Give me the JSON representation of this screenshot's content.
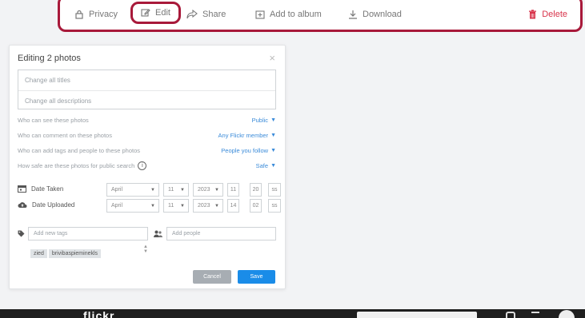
{
  "toolbar": {
    "privacy": "Privacy",
    "edit": "Edit",
    "share": "Share",
    "add_to_album": "Add to album",
    "download": "Download",
    "delete": "Delete"
  },
  "dialog": {
    "title": "Editing 2 photos",
    "close": "×",
    "titles_placeholder": "Change all titles",
    "descriptions_placeholder": "Change all descriptions",
    "options": [
      {
        "label": "Who can see these photos",
        "value": "Public"
      },
      {
        "label": "Who can comment on these photos",
        "value": "Any Flickr member"
      },
      {
        "label": "Who can add tags and people to these photos",
        "value": "People you follow"
      },
      {
        "label": "How safe are these photos for public search",
        "value": "Safe"
      }
    ],
    "date_taken": {
      "label": "Date Taken",
      "month": "April",
      "day": "11",
      "year": "2023",
      "hour": "11",
      "minute": "20",
      "second": "ss"
    },
    "date_uploaded": {
      "label": "Date Uploaded",
      "month": "April",
      "day": "11",
      "year": "2023",
      "hour": "14",
      "minute": "02",
      "second": "ss"
    },
    "tags_placeholder": "Add new tags",
    "people_placeholder": "Add people",
    "tags": [
      "zied",
      "brivibaspieminekls"
    ],
    "cancel": "Cancel",
    "save": "Save"
  },
  "footer": {
    "logo": "flickr"
  },
  "colors": {
    "highlight": "#a8193a",
    "link": "#3b8bd9",
    "save": "#1a8ce8",
    "delete": "#d8344b"
  }
}
